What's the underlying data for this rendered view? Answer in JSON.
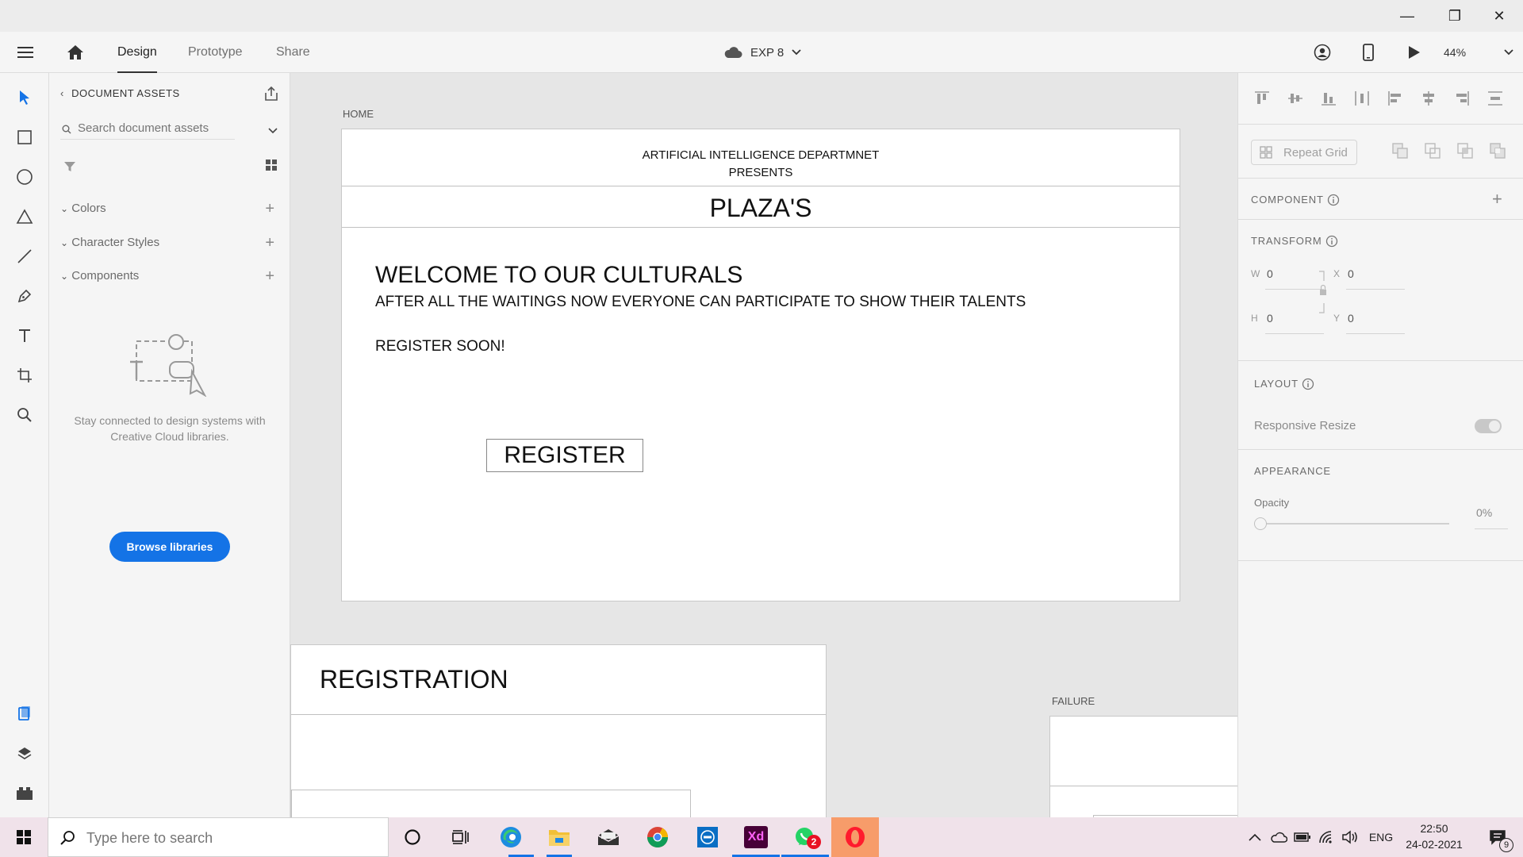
{
  "window": {
    "minimize": "—",
    "restore": "❐",
    "close": "✕"
  },
  "menubar": {
    "tabs": [
      "Design",
      "Prototype",
      "Share"
    ],
    "doc_name": "EXP 8",
    "zoom": "44%"
  },
  "assets": {
    "header": "DOCUMENT ASSETS",
    "search_placeholder": "Search document assets",
    "sections": [
      "Colors",
      "Character Styles",
      "Components"
    ],
    "empty_text": "Stay connected to design systems with Creative Cloud libraries.",
    "browse_label": "Browse libraries"
  },
  "canvas": {
    "home_label": "HOME",
    "home": {
      "header_line1": "ARTIFICIAL INTELLIGENCE DEPARTMNET",
      "header_line2": "PRESENTS",
      "title": "PLAZA'S",
      "welcome": "WELCOME TO OUR CULTURALS",
      "subtitle": "AFTER ALL THE WAITINGS NOW EVERYONE CAN PARTICIPATE TO SHOW THEIR TALENTS",
      "register_soon": "REGISTER SOON!",
      "register_button": "REGISTER"
    },
    "registration_title": "REGISTRATION",
    "failure_label": "FAILURE"
  },
  "props": {
    "repeat_grid": "Repeat Grid",
    "component": "COMPONENT",
    "transform": "TRANSFORM",
    "w_label": "W",
    "w_value": "0",
    "h_label": "H",
    "h_value": "0",
    "x_label": "X",
    "x_value": "0",
    "y_label": "Y",
    "y_value": "0",
    "layout": "LAYOUT",
    "responsive_resize": "Responsive Resize",
    "appearance": "APPEARANCE",
    "opacity_label": "Opacity",
    "opacity_value": "0%"
  },
  "taskbar": {
    "search_placeholder": "Type here to search",
    "xd_label": "Xd",
    "whatsapp_badge": "2",
    "lang": "ENG",
    "time": "22:50",
    "date": "24-02-2021",
    "notification_count": "9"
  },
  "colors": {
    "accent": "#1473e6",
    "taskbar": "#f0e2ea",
    "xd_purple": "#470137",
    "xd_pink": "#ff61f6",
    "opera": "#ff1b2d"
  }
}
